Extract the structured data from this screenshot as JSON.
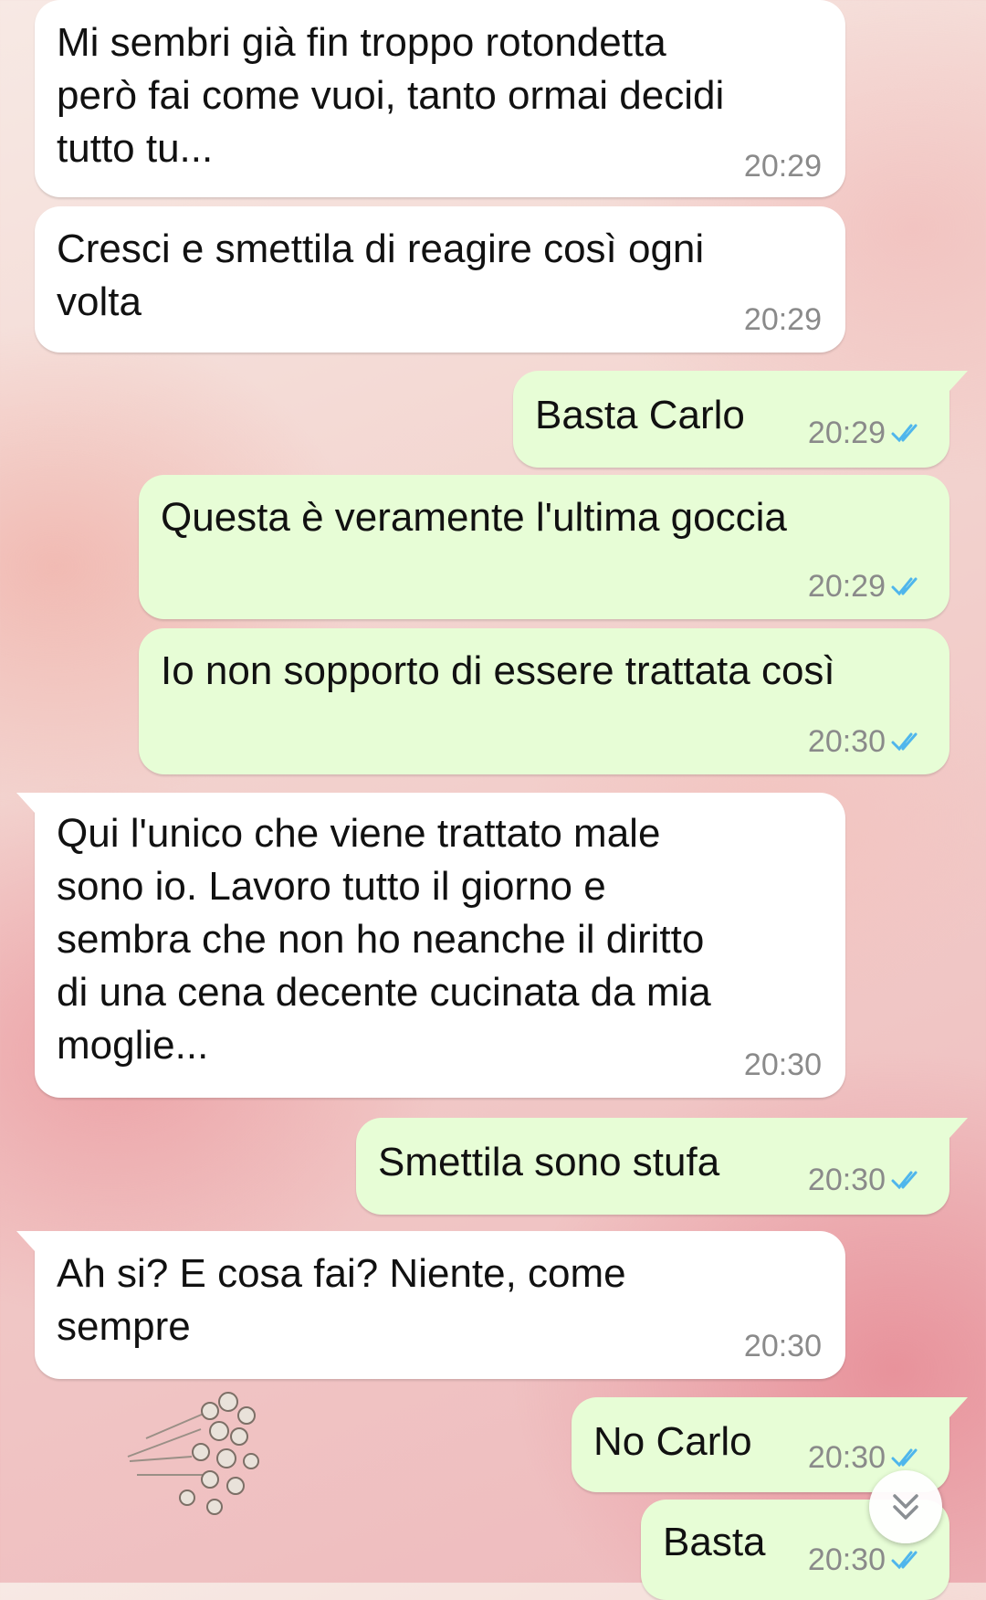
{
  "messages": [
    {
      "dir": "in",
      "text": "Mi sembri già fin troppo rotondetta\nperò fai come vuoi, tanto ormai decidi\ntutto tu...",
      "time": "20:29"
    },
    {
      "dir": "in",
      "text": "Cresci e smettila di reagire così ogni\nvolta",
      "time": "20:29"
    },
    {
      "dir": "out",
      "text": "Basta Carlo",
      "time": "20:29",
      "status": "read"
    },
    {
      "dir": "out",
      "text": "Questa è veramente l'ultima goccia",
      "time": "20:29",
      "status": "read"
    },
    {
      "dir": "out",
      "text": "Io non sopporto di essere trattata così",
      "time": "20:30",
      "status": "read"
    },
    {
      "dir": "in",
      "text": "Qui l'unico che viene trattato male\nsono io. Lavoro tutto il giorno e\nsembra che non ho neanche il diritto\ndi una cena decente cucinata da mia\nmoglie...",
      "time": "20:30"
    },
    {
      "dir": "out",
      "text": "Smettila sono stufa",
      "time": "20:30",
      "status": "read"
    },
    {
      "dir": "in",
      "text": "Ah si? E cosa fai? Niente, come\nsempre",
      "time": "20:30"
    },
    {
      "dir": "out",
      "text": "No Carlo",
      "time": "20:30",
      "status": "read"
    },
    {
      "dir": "out",
      "text": "Basta",
      "time": "20:30",
      "status": "read"
    }
  ],
  "icons": {
    "read_receipt": "double-check-icon",
    "scroll_down": "chevron-double-down-icon"
  },
  "colors": {
    "incoming_bubble": "#ffffff",
    "outgoing_bubble": "#e7fdd6",
    "read_tick": "#4fb6ec",
    "timestamp": "#8a8a8a"
  }
}
